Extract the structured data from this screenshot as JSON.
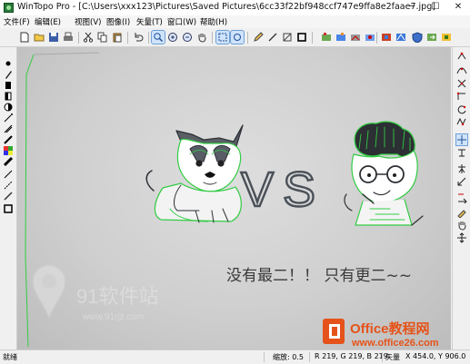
{
  "window": {
    "title": "WinTopo Pro - [C:\\Users\\xxx123\\Pictures\\Saved Pictures\\6cc33f22bf948ccf747e9ffa8e2faae7.jpg]",
    "min_glyph": "─",
    "max_glyph": "☐",
    "close_glyph": "✕"
  },
  "menu": [
    "文件(F)",
    "编辑(E)",
    "视图(V)",
    "图像(I)",
    "矢量(T)",
    "窗口(W)",
    "帮助(H)"
  ],
  "canvas": {
    "vs_text": "VS",
    "handwriting": "没有最二！！  只有更二~~"
  },
  "watermarks": {
    "left_name": "91软件站",
    "left_url": "www.91rjz.com",
    "right_name": "Office教程网",
    "right_url": "www.office26.com"
  },
  "status": {
    "ready": "就绪",
    "zoom": "缩放: 0.5",
    "rgb": "R 219, G 219, B 219",
    "mode": "矢量",
    "coords": "X 454.0, Y 906.0"
  },
  "colors": {
    "trace_green": "#33cc44",
    "accent_blue": "#cfe3fb",
    "office_orange": "#e5531a"
  },
  "icons": {
    "top_toolbar": [
      "new-file-icon",
      "open-folder-icon",
      "save-icon",
      "print-icon",
      "cut-icon",
      "copy-icon",
      "paste-icon",
      "undo-icon",
      "zoom-tool-icon",
      "zoom-in-icon",
      "zoom-out-icon",
      "pan-hand-icon",
      "select-region-icon",
      "select-all-icon",
      "pencil-icon",
      "line-tool-icon",
      "polyline-icon",
      "crop-icon",
      "raster-tool-icon",
      "filter-tool-icon",
      "thin-tool-icon",
      "layer-tool-icon",
      "color-tool-icon",
      "vectorize-icon",
      "shield-icon",
      "export-icon",
      "options-icon"
    ],
    "left_toolbar": [
      "dot-icon",
      "pen-icon",
      "fill-icon",
      "half-fill-icon",
      "contrast-icon",
      "spray-icon",
      "wand-icon",
      "draw-icon",
      "palette-icon",
      "line-width-icon",
      "thin-line-icon",
      "dash-line-icon",
      "diagonal-line-icon",
      "rectangle-icon"
    ],
    "right_toolbar": [
      "vector-node-icon",
      "curve-icon",
      "cross-icon",
      "bend-icon",
      "rotate-icon",
      "zigzag-icon",
      "star-icon",
      "cursor-plus-icon",
      "text-icon",
      "angle-icon",
      "arrow-tool-icon",
      "edit-node-icon",
      "hand-tool-icon",
      "move-tool-icon"
    ]
  }
}
